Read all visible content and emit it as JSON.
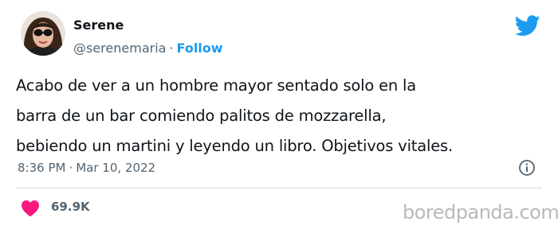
{
  "user": {
    "display_name": "Serene",
    "handle": "@serenemaria",
    "separator": "·",
    "follow_label": "Follow"
  },
  "tweet": {
    "text": "Acabo de ver a un hombre mayor sentado solo en la\nbarra de un bar comiendo palitos de mozzarella,\nbebiendo un martini y leyendo un libro. Objetivos vitales.",
    "time": "8:36 PM",
    "separator": "·",
    "date": "Mar 10, 2022"
  },
  "engagement": {
    "likes": "69.9K"
  },
  "watermark": "boredpanda.com",
  "icons": {
    "brand": "twitter-bird-icon",
    "info": "info-icon",
    "like": "heart-icon"
  },
  "colors": {
    "accent": "#1d9bf0",
    "heart": "#f91880",
    "text": "#0f1419",
    "muted": "#536471",
    "divider": "#cfd9de"
  }
}
